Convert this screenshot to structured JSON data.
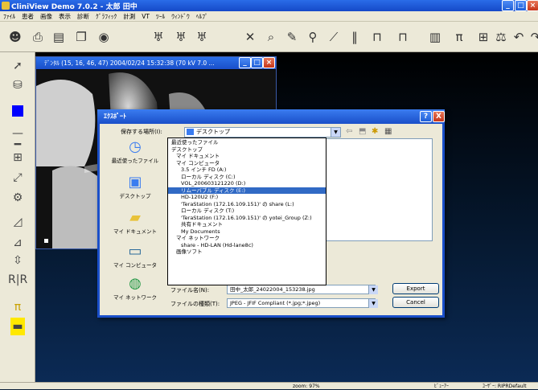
{
  "app": {
    "title": "CliniView Demo 7.0.2 - 太郎 田中"
  },
  "menu": [
    "ﾌｧｲﾙ",
    "患者",
    "画像",
    "表示",
    "診断",
    "ｸﾞﾗﾌｨｯｸ",
    "計測",
    "VT",
    "ﾂｰﾙ",
    "ｳｨﾝﾄﾞｳ",
    "ﾍﾙﾌﾟ"
  ],
  "image_window": {
    "title": "ﾃﾞﾝﾀﾙ (15, 16, 46, 47) 2004/02/24 15:32:38 (70 kV 7.0 ..."
  },
  "dialog": {
    "title": "ｴｸｽﾎﾟｰﾄ",
    "lookin_label": "保存する場所(I):",
    "lookin_value": "デスクトップ",
    "places": [
      {
        "label": "最近使ったファイル",
        "icon": "recent-icon"
      },
      {
        "label": "デスクトップ",
        "icon": "desktop-icon"
      },
      {
        "label": "マイ ドキュメント",
        "icon": "documents-icon"
      },
      {
        "label": "マイ コンピュータ",
        "icon": "computer-icon"
      },
      {
        "label": "マイ ネットワーク",
        "icon": "network-icon"
      }
    ],
    "dropdown_items": [
      "最近使ったファイル",
      "デスクトップ",
      "マイ ドキュメント",
      "マイ コンピュータ",
      "3.5 インチ FD (A:)",
      "ローカル ディスク (C:)",
      "VOL_200603121220 (D:)",
      "リムーバブル ディスク (E:)",
      "HD-120U2 (F:)",
      "'TeraStation (172.16.109.151)' の share (L:)",
      "ローカル ディスク (T:)",
      "'TeraStation (172.16.109.151)' の yotei_Group (Z:)",
      "共有ドキュメント",
      "My Documents",
      "マイ ネットワーク",
      "share - HD-LAN (Hd-lane8c)",
      "画像ソフト"
    ],
    "selected_index": 7,
    "filename_label": "ファイル名(N):",
    "filename_value": "田中_太郎_24022004_153238.jpg",
    "filetype_label": "ファイルの種類(T):",
    "filetype_value": "JPEG - JFIF Compliant (*.jpg;*.jpeg)",
    "export_button": "Export",
    "cancel_button": "Cancel",
    "help_button": "?",
    "close_button": "X"
  },
  "status": {
    "zoom": "zoom: 97%",
    "mode": "ﾋﾞｭｰｱｰ",
    "user": "ﾕｰｻﾞｰ: RIPRDefault"
  }
}
